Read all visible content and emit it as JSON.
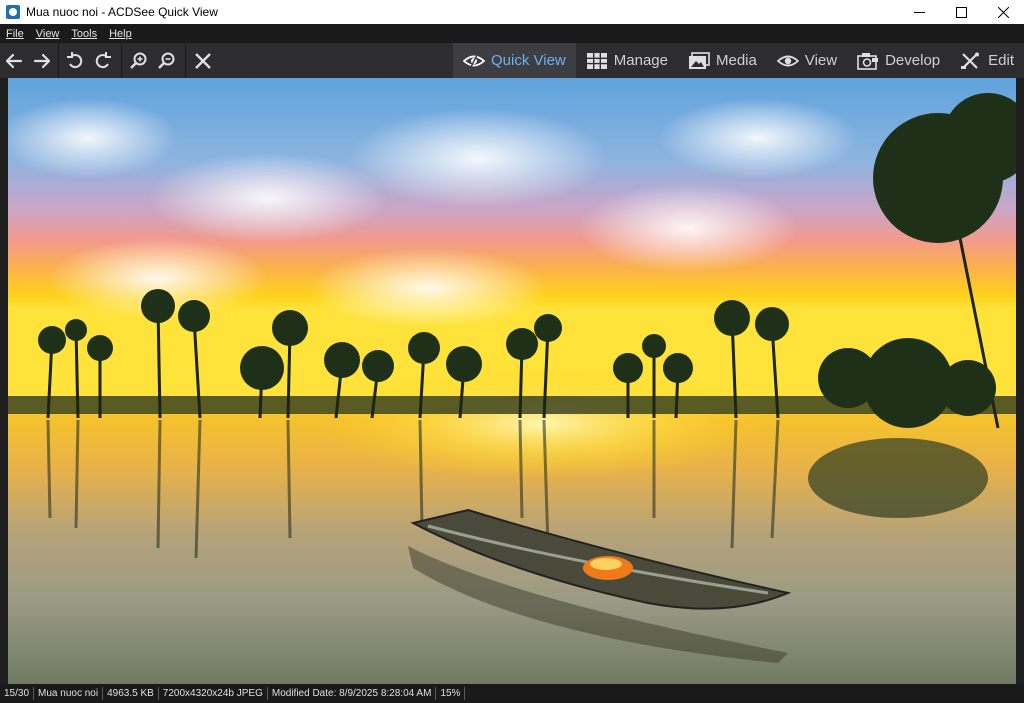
{
  "window": {
    "title": "Mua nuoc noi - ACDSee Quick View"
  },
  "menu": {
    "file": "File",
    "view": "View",
    "tools": "Tools",
    "help": "Help"
  },
  "modes": {
    "quick_view": "Quick View",
    "manage": "Manage",
    "media": "Media",
    "view": "View",
    "develop": "Develop",
    "edit": "Edit"
  },
  "status": {
    "position": "15/30",
    "filename": "Mua nuoc noi",
    "filesize": "4963.5 KB",
    "dimensions": "7200x4320x24b JPEG",
    "modified": "Modified Date: 8/9/2025 8:28:04 AM",
    "zoom": "15%"
  },
  "colors": {
    "active_tab_text": "#6cb2f2",
    "toolbar_bg": "#2d2d30",
    "menubar_bg": "#1a1a1a"
  },
  "icons": [
    "back-arrow-icon",
    "forward-arrow-icon",
    "rotate-left-icon",
    "rotate-right-icon",
    "zoom-in-icon",
    "zoom-out-icon",
    "close-image-icon",
    "eye-icon",
    "grid-icon",
    "media-icon",
    "develop-icon",
    "edit-tools-icon"
  ]
}
